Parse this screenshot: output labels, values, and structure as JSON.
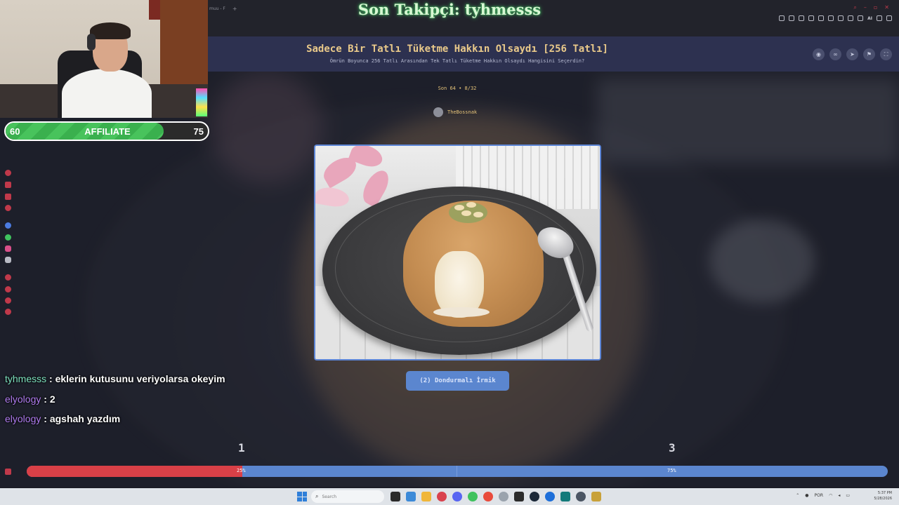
{
  "overlay": {
    "last_follower": "Son Takipçi: tyhmesss",
    "affiliate": {
      "start": "60",
      "label": "AFFILIATE",
      "goal": "75",
      "progress_fraction": 0.78
    }
  },
  "browser": {
    "tab_fragment": "muu - F",
    "newtab_icon": "+",
    "ai_label": "AI"
  },
  "site": {
    "title": "Sadece Bir Tatlı Tüketme Hakkın Olsaydı [256 Tatlı]",
    "subtitle": "Ömrün Boyunca 256 Tatlı Arasından Tek Tatlı Tüketme Hakkın Olsaydı Hangisini Seçerdin?",
    "header_icons": [
      "eye-icon",
      "link-icon",
      "send-icon",
      "flag-icon",
      "fullscreen-icon"
    ],
    "round_info": "Son 64 • 8/32",
    "creator": "TheBossnak",
    "choice_label": "(2) Dondurmalı İrmik"
  },
  "chat": [
    {
      "user": "tyhmesss",
      "user_color": "#7fe3c0",
      "message": " : eklerin kutusunu veriyolarsa okeyim"
    },
    {
      "user": "elyology",
      "user_color": "#b07cf0",
      "message": " : 2"
    },
    {
      "user": "elyology",
      "user_color": "#b07cf0",
      "message": " : agshah yazdım"
    }
  ],
  "vote": {
    "left_label": "1",
    "right_label": "3",
    "left_percent": "25%",
    "right_percent": "75%",
    "left_fraction": 0.25,
    "left_color": "#d94047",
    "right_color": "#5b86cf"
  },
  "taskbar": {
    "search_placeholder": "Search",
    "clock_time": "5:37 PM",
    "clock_date": "5/28/2026",
    "lang": "POR"
  }
}
